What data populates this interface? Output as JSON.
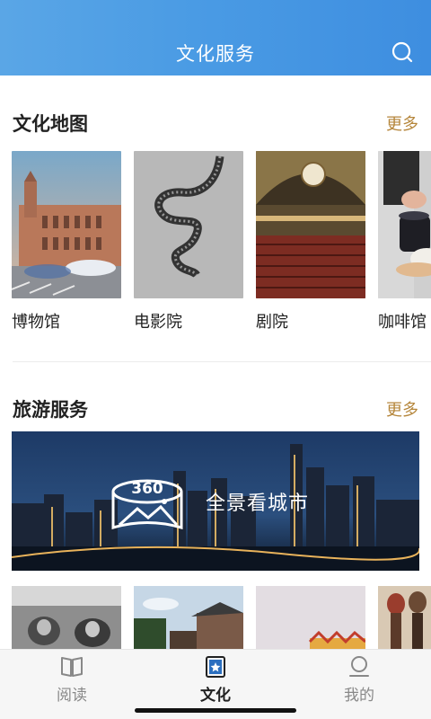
{
  "header": {
    "title": "文化服务",
    "search_icon": "search-icon"
  },
  "culture_map": {
    "title": "文化地图",
    "more": "更多",
    "items": [
      {
        "label": "博物馆"
      },
      {
        "label": "电影院"
      },
      {
        "label": "剧院"
      },
      {
        "label": "咖啡馆"
      }
    ]
  },
  "travel": {
    "title": "旅游服务",
    "more": "更多",
    "banner": {
      "text": "全景看城市",
      "badge": "360"
    }
  },
  "tabbar": {
    "tabs": [
      {
        "label": "阅读",
        "icon": "book-icon"
      },
      {
        "label": "文化",
        "icon": "culture-icon",
        "active": true
      },
      {
        "label": "我的",
        "icon": "profile-icon"
      }
    ]
  }
}
